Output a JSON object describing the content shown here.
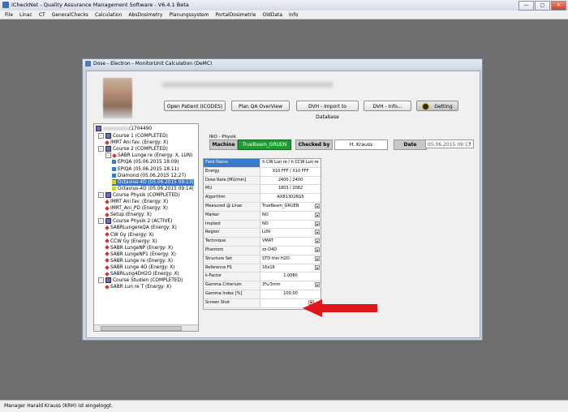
{
  "app": {
    "title": "iCheckNet - Quality Assurance Management Software - V6.4.1 Beta",
    "min": "—",
    "max": "▢",
    "close": "✕"
  },
  "menu": [
    "File",
    "Linac",
    "CT",
    "GeneralChecks",
    "Calculation",
    "AbsDosimetry",
    "Planungssystem",
    "PortalDosimetrie",
    "OldData",
    "Info"
  ],
  "status": "Manager Harald Krauss (KRH) ist eingeloggt.",
  "dialog": {
    "title": "Dose - Electron - MonitorUnit Calculation (DeMC)",
    "buttons": {
      "open_patient": "Open Patient (ICODES)",
      "plan_qa": "Plan QA OverView",
      "dvh_import": "DVH - Import to Database",
      "dvh_info": "DVH - Info...",
      "getting": "Getting"
    },
    "iro": "IRO - Physik",
    "machine_label": "Machine",
    "machine_value": "TrueBeam_GRUEN",
    "checked_label": "Checked by",
    "checked_value": "H. Krauss",
    "date_label": "Date",
    "date_value": "05.06.2015 09:13"
  },
  "tree": {
    "root_suffix": "(1704490",
    "nodes": [
      {
        "text": "Course 1 (COMPLETED)",
        "type": "course",
        "exp": "-"
      },
      {
        "text": "IMRT Ani fav. (Energy: X)",
        "type": "plan"
      },
      {
        "text": "Course 2 (COMPLETED)",
        "type": "course",
        "exp": "-"
      },
      {
        "text": "SABR Lunge re (Energy: X, LUN)",
        "type": "plan",
        "exp": "-"
      },
      {
        "text": "EPIQA (05.06.2015 18:09)",
        "type": "meas"
      },
      {
        "text": "EPIQA (05.06.2015 18:11)",
        "type": "meas"
      },
      {
        "text": "Diamond (05.06.2015 12:27)",
        "type": "meas"
      },
      {
        "text": "Octavius-4D (05.06.2015 09:13)",
        "type": "oct",
        "selected": true
      },
      {
        "text": "Octavius-4D (05.06.2015 09:14)",
        "type": "oct"
      },
      {
        "text": "Course Physik (COMPLETED)",
        "type": "course",
        "exp": "-"
      },
      {
        "text": "IMRT Ani fav. (Energy: X)",
        "type": "plan"
      },
      {
        "text": "IMRT_Ani_PD (Energy: X)",
        "type": "plan"
      },
      {
        "text": "Setup (Energy: X)",
        "type": "plan"
      },
      {
        "text": "Course Physik 2 (ACTIVE)",
        "type": "course",
        "exp": "-"
      },
      {
        "text": "SABRLungereQA (Energy: X)",
        "type": "plan"
      },
      {
        "text": "CW Gy (Energy: X)",
        "type": "plan"
      },
      {
        "text": "CCW Gy (Energy: X)",
        "type": "plan"
      },
      {
        "text": "SABR LungeNP (Energy: X)",
        "type": "plan"
      },
      {
        "text": "SABR LungeNP1 (Energy: X)",
        "type": "plan"
      },
      {
        "text": "SABR Lunge re (Energy: X)",
        "type": "plan"
      },
      {
        "text": "SABR Lunge 4D (Energy: X)",
        "type": "plan"
      },
      {
        "text": "SABRLung4DH2O (Energy: X)",
        "type": "plan"
      },
      {
        "text": "Course Studien (COMPLETED)",
        "type": "course",
        "exp": "-"
      },
      {
        "text": "SABR Lun re T (Energy: X)",
        "type": "plan"
      }
    ]
  },
  "grid": [
    {
      "label": "Field Name",
      "value": "h CW Lun re / h CCW Lun re",
      "header": true
    },
    {
      "label": "Energy",
      "value": "X10 FFF / X10 FFF"
    },
    {
      "label": "Dose Rate [MU/min]",
      "value": "2400 / 2400"
    },
    {
      "label": "MU",
      "value": "1803 / 2082"
    },
    {
      "label": "Algorithm",
      "value": "AXB13026G5"
    },
    {
      "label": "Measured @ Linac",
      "value": "TrueBeam_GRUEN",
      "select": true
    },
    {
      "label": "Marker",
      "value": "NO",
      "select": true
    },
    {
      "label": "Implant",
      "value": "NO",
      "select": true
    },
    {
      "label": "Region",
      "value": "LUN",
      "select": true
    },
    {
      "label": "Technique",
      "value": "VMAT",
      "select": true
    },
    {
      "label": "Phantom",
      "value": "zz-O4D",
      "select": true
    },
    {
      "label": "Structure Set",
      "value": "STD thin H2O",
      "select": true
    },
    {
      "label": "Reference FS",
      "value": "16x16",
      "select": true
    },
    {
      "label": "k-Factor",
      "value": "1.0080"
    },
    {
      "label": "Gamma Criterium",
      "value": "3%/3mm",
      "select": true
    },
    {
      "label": "Gamma Index [%]",
      "value": "100.00"
    },
    {
      "label": "Screen Shot",
      "value": "",
      "shot": true
    }
  ],
  "colors": {
    "machine_bg": "#1f9b34",
    "selection": "#3b73c6",
    "arrow": "#e0161a"
  }
}
